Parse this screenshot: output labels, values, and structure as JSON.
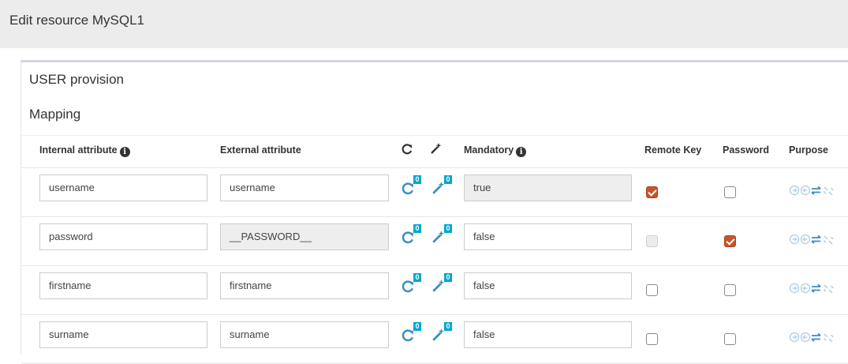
{
  "header": {
    "title": "Edit resource MySQL1"
  },
  "panel": {
    "provision_title": "USER provision",
    "mapping_title": "Mapping"
  },
  "columns": {
    "internal": "Internal attribute",
    "external": "External attribute",
    "mandatory": "Mandatory",
    "remote_key": "Remote Key",
    "password": "Password",
    "purpose": "Purpose"
  },
  "rows": [
    {
      "internal": "username",
      "external": "username",
      "external_readonly": false,
      "transformers": "0",
      "jexl": "0",
      "mandatory": "true",
      "mandatory_readonly": true,
      "remote_key": true,
      "remote_key_disabled": false,
      "password": false
    },
    {
      "internal": "password",
      "external": "__PASSWORD__",
      "external_readonly": true,
      "transformers": "0",
      "jexl": "0",
      "mandatory": "false",
      "mandatory_readonly": false,
      "remote_key": false,
      "remote_key_disabled": true,
      "password": true
    },
    {
      "internal": "firstname",
      "external": "firstname",
      "external_readonly": false,
      "transformers": "0",
      "jexl": "0",
      "mandatory": "false",
      "mandatory_readonly": false,
      "remote_key": false,
      "remote_key_disabled": false,
      "password": false
    },
    {
      "internal": "surname",
      "external": "surname",
      "external_readonly": false,
      "transformers": "0",
      "jexl": "0",
      "mandatory": "false",
      "mandatory_readonly": false,
      "remote_key": false,
      "remote_key_disabled": false,
      "password": false
    }
  ],
  "colors": {
    "accent_badge": "#00a7d0",
    "icon_blue": "#3c8dbc",
    "checked": "#c8552a",
    "purpose_faded": "#b7d3e3"
  },
  "icons": {
    "refresh_header": "refresh-icon",
    "wand_header": "magic-wand-icon",
    "info": "info-icon",
    "purpose": [
      "circle-arrow-right-icon",
      "circle-arrow-left-icon",
      "exchange-icon",
      "unlink-icon"
    ]
  }
}
